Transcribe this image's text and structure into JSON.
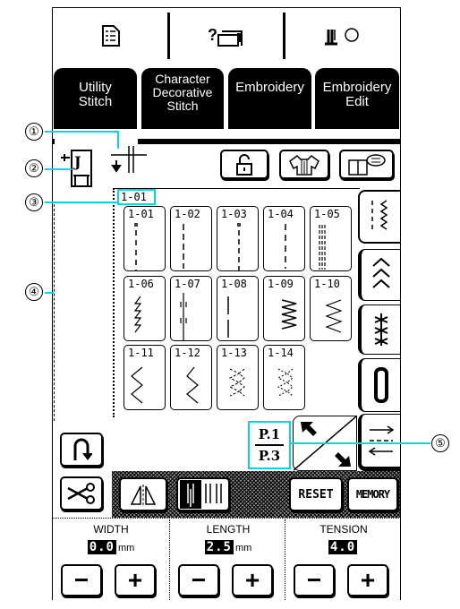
{
  "top_icons": [
    "manual-icon",
    "help-machine-icon",
    "thread-change-icon"
  ],
  "tabs": [
    {
      "label": "Utility\nStitch",
      "active": true
    },
    {
      "label": "Character\nDecorative\nStitch"
    },
    {
      "label": "Embroidery"
    },
    {
      "label": "Embroidery\nEdit"
    }
  ],
  "presser_foot": {
    "code": "J"
  },
  "selected_stitch": "1-01",
  "stitches": [
    "1-01",
    "1-02",
    "1-03",
    "1-04",
    "1-05",
    "1-06",
    "1-07",
    "1-08",
    "1-09",
    "1-10",
    "1-11",
    "1-12",
    "1-13",
    "1-14"
  ],
  "category_tabs": [
    "straight-zigzag-icon",
    "overcasting-icon",
    "decorative-icon",
    "buttonhole-icon"
  ],
  "page": {
    "current": "P.1",
    "total": "P.3"
  },
  "toolbar": {
    "reset": "RESET",
    "memory": "MEMORY"
  },
  "settings": [
    {
      "label": "WIDTH",
      "value": "0.0",
      "unit": "mm"
    },
    {
      "label": "LENGTH",
      "value": "2.5",
      "unit": "mm"
    },
    {
      "label": "TENSION",
      "value": "4.0",
      "unit": ""
    }
  ],
  "callouts": [
    "①",
    "②",
    "③",
    "④",
    "⑤"
  ],
  "colors": {
    "callout_line": "#00d8e0",
    "screen_bg": "#ffffff",
    "active": "#000000"
  }
}
